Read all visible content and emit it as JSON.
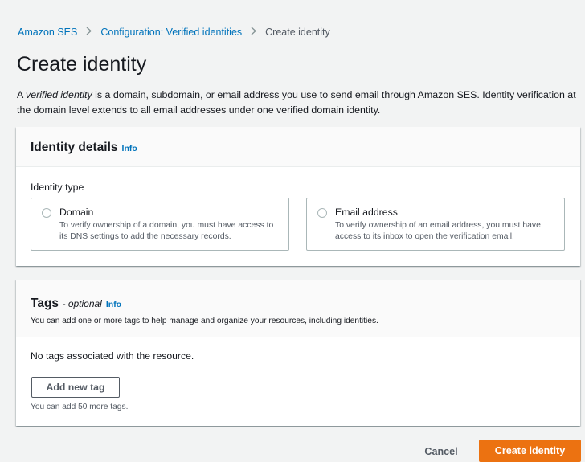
{
  "breadcrumb": {
    "items": [
      "Amazon SES",
      "Configuration: Verified identities"
    ],
    "current": "Create identity",
    "separator": ">"
  },
  "page": {
    "title": "Create identity",
    "description_em": "verified identity",
    "description_prefix": "A ",
    "description_rest": " is a domain, subdomain, or email address you use to send email through Amazon SES. Identity verification at the domain level extends to all email addresses under one verified domain identity."
  },
  "identity_details": {
    "title": "Identity details",
    "info": "Info",
    "identity_type_label": "Identity type",
    "options": [
      {
        "label": "Domain",
        "description": "To verify ownership of a domain, you must have access to its DNS settings to add the necessary records.",
        "selected": false
      },
      {
        "label": "Email address",
        "description": "To verify ownership of an email address, you must have access to its inbox to open the verification email.",
        "selected": false
      }
    ]
  },
  "tags": {
    "title": "Tags",
    "optional": "- optional",
    "info": "Info",
    "description": "You can add one or more tags to help manage and organize your resources, including identities.",
    "empty_text": "No tags associated with the resource.",
    "add_button": "Add new tag",
    "limit_text": "You can add 50 more tags."
  },
  "footer": {
    "cancel": "Cancel",
    "submit": "Create identity"
  },
  "colors": {
    "link": "#0073bb",
    "primary_button": "#ec7211",
    "background": "#f2f3f3"
  }
}
